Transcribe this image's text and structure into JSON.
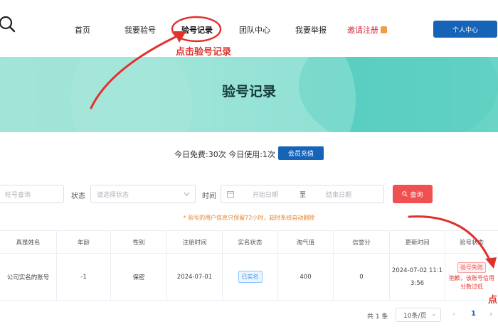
{
  "header": {
    "nav": [
      "首页",
      "我要验号",
      "验号记录",
      "团队中心",
      "我要举报",
      "邀请注册"
    ],
    "personal_center": "个人中心"
  },
  "annotations": {
    "click_record": "点击验号记录",
    "right_partial": "点"
  },
  "banner": {
    "title": "验号记录"
  },
  "usage": {
    "text": "今日免费:30次 今日使用:1次",
    "recharge_label": "会员充值"
  },
  "filters": {
    "account_placeholder": "旺号查询",
    "status_label": "状态",
    "status_placeholder": "请选择状态",
    "time_label": "时间",
    "start_placeholder": "开始日期",
    "to": "至",
    "end_placeholder": "结束日期",
    "query_label": "查询"
  },
  "notice": "* 验号的用户信息只保留72小时，超时系统自动删除",
  "table": {
    "headers": [
      "真是姓名",
      "年龄",
      "性别",
      "注册时间",
      "实名状态",
      "淘气值",
      "信誉分",
      "更新时间",
      "验号状态"
    ],
    "rows": [
      {
        "name": "公司实名的账号",
        "age": "-1",
        "gender": "保密",
        "reg_date": "2024-07-01",
        "realname": "已实名",
        "naughty": "400",
        "credit": "0",
        "update_l1": "2024-07-02 11:1",
        "update_l2": "3:56",
        "status_tag": "验号失败",
        "status_msg_l1": "抱歉，该账号信用",
        "status_msg_l2": "分数过低"
      }
    ]
  },
  "pagination": {
    "total": "共 1 条",
    "page_size": "10条/页",
    "current": "1",
    "prev": "‹",
    "next": "›"
  },
  "colors": {
    "primary": "#1564b8",
    "danger": "#ef5050",
    "annotation": "#e0312c"
  }
}
